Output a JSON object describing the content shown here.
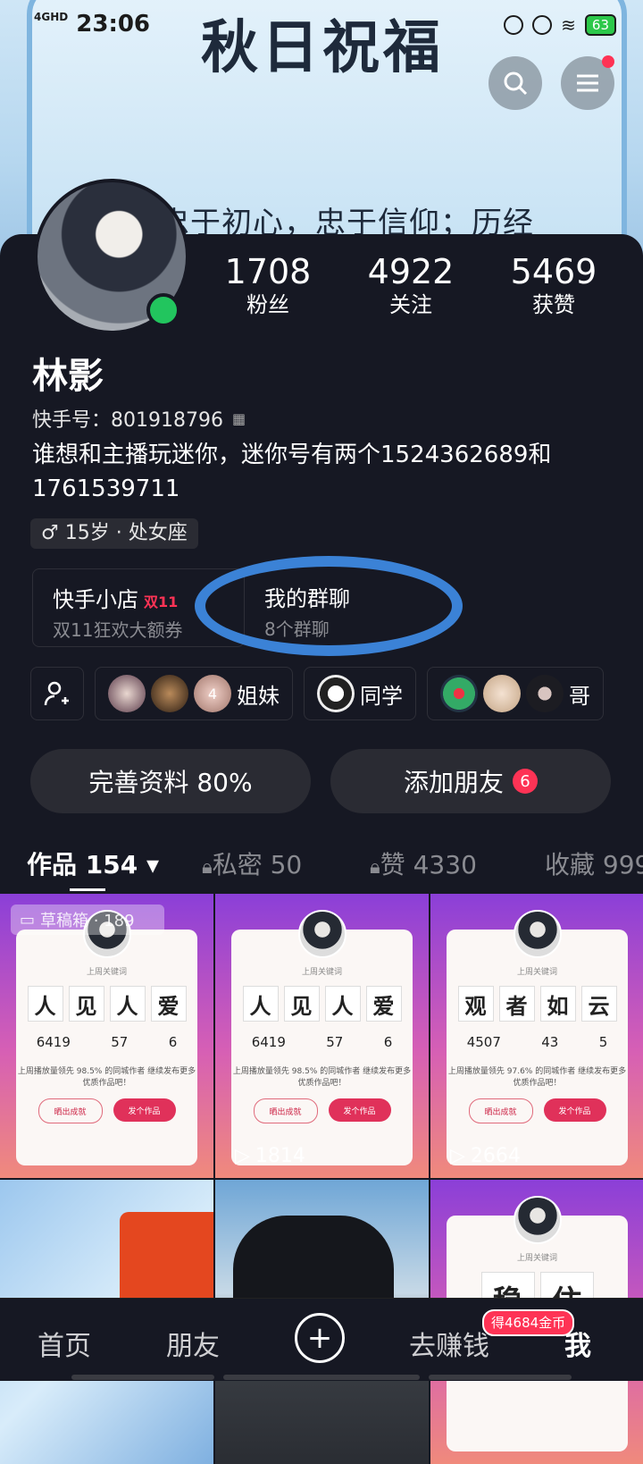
{
  "status_bar": {
    "network": "4GHD",
    "time": "23:06",
    "battery": "63"
  },
  "banner": {
    "title": "秋日祝福",
    "line": "忠于初心，忠于信仰；历经"
  },
  "profile": {
    "name": "林影",
    "kuaishou_id": "快手号：801918796",
    "bio": "谁想和主播玩迷你，迷你号有两个1524362689和1761539711",
    "tag": "♂ 15岁 · 处女座",
    "stats": [
      {
        "value": "1708",
        "label": "粉丝"
      },
      {
        "value": "4922",
        "label": "关注"
      },
      {
        "value": "5469",
        "label": "获赞"
      }
    ]
  },
  "shop": {
    "title": "快手小店",
    "badge": "双11",
    "subtitle": "双11狂欢大额券"
  },
  "group_chat": {
    "title": "我的群聊",
    "subtitle": "8个群聊"
  },
  "friend_groups": [
    {
      "label": "4",
      "name": "姐妹"
    },
    {
      "name": "同学"
    },
    {
      "name": "哥"
    }
  ],
  "actions": {
    "complete": "完善资料 80%",
    "add_friend": "添加朋友",
    "add_friend_badge": "6"
  },
  "tabs": [
    {
      "label": "作品 154 ▾"
    },
    {
      "label": "私密 50"
    },
    {
      "label": "赞 4330"
    },
    {
      "label": "收藏 999"
    }
  ],
  "draft": {
    "label": "草稿箱 · 189"
  },
  "cards": [
    {
      "cap": "上周关键词",
      "words": [
        "人",
        "见",
        "人",
        "爱"
      ],
      "nums": [
        "6419",
        "57",
        "6"
      ],
      "note": "上周播放量领先 98.5% 的同城作者 继续发布更多优质作品吧！",
      "btn1": "晒出成就",
      "btn2": "发个作品",
      "plays": ""
    },
    {
      "cap": "上周关键词",
      "words": [
        "人",
        "见",
        "人",
        "爱"
      ],
      "nums": [
        "6419",
        "57",
        "6"
      ],
      "note": "上周播放量领先 98.5% 的同城作者 继续发布更多优质作品吧！",
      "btn1": "晒出成就",
      "btn2": "发个作品",
      "plays": "1814"
    },
    {
      "cap": "上周关键词",
      "words": [
        "观",
        "者",
        "如",
        "云"
      ],
      "nums": [
        "4507",
        "43",
        "5"
      ],
      "note": "上周播放量领先 97.6% 的同城作者 继续发布更多优质作品吧！",
      "btn1": "晒出成就",
      "btn2": "发个作品",
      "plays": "2664"
    }
  ],
  "third_row": {
    "cap": "上周关键词",
    "words": [
      "稳",
      "住"
    ]
  },
  "nav": {
    "home": "首页",
    "friends": "朋友",
    "earn": "去赚钱",
    "coin_badge": "得4684金币",
    "me": "我",
    "plus": "+"
  },
  "colors": {
    "bg": "#161823",
    "accent": "#fe3355",
    "online": "#22c55e",
    "ring": "#3b82d6"
  }
}
